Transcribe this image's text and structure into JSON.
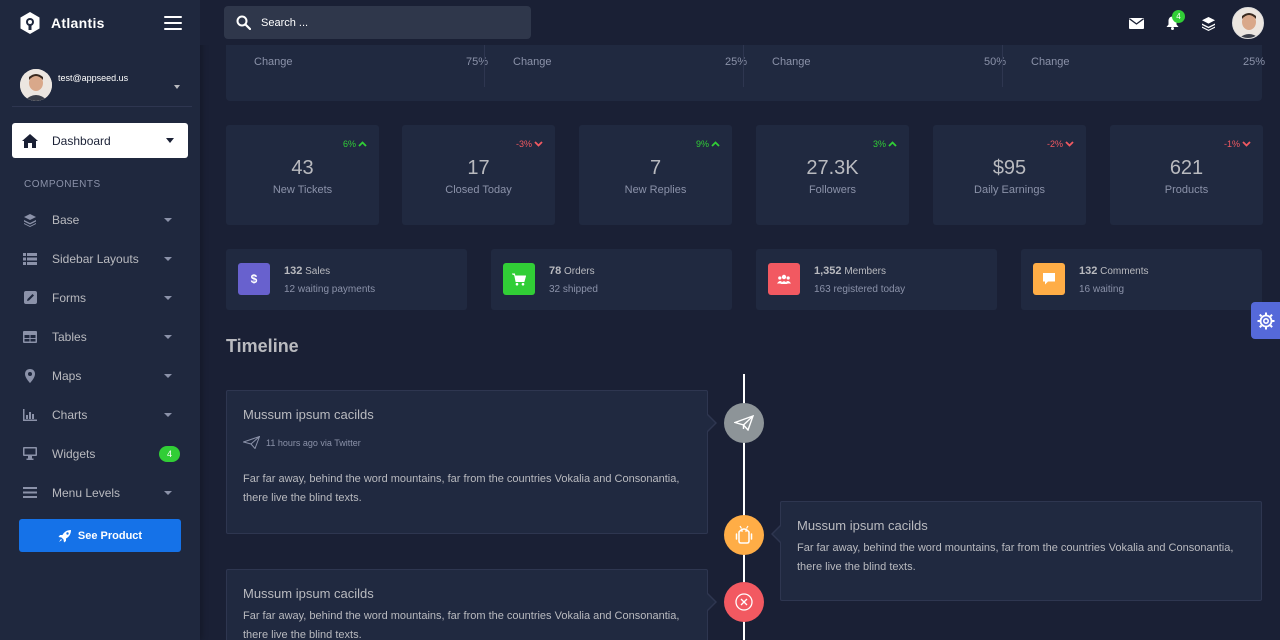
{
  "app": {
    "name": "Atlantis"
  },
  "user": {
    "email": "test@appseed.us"
  },
  "sidebar": {
    "active_item": "Dashboard",
    "section_title": "COMPONENTS",
    "items": [
      {
        "label": "Base",
        "icon": "layers-icon"
      },
      {
        "label": "Sidebar Layouts",
        "icon": "list-icon"
      },
      {
        "label": "Forms",
        "icon": "pen-square-icon"
      },
      {
        "label": "Tables",
        "icon": "table-icon"
      },
      {
        "label": "Maps",
        "icon": "map-marker-icon"
      },
      {
        "label": "Charts",
        "icon": "bar-chart-icon"
      },
      {
        "label": "Widgets",
        "icon": "desktop-icon",
        "badge": "4"
      },
      {
        "label": "Menu Levels",
        "icon": "bars-icon"
      }
    ],
    "cta": "See Product"
  },
  "header": {
    "search_placeholder": "Search ...",
    "notification_count": "4"
  },
  "change_row": [
    {
      "label": "Change",
      "value": "75%"
    },
    {
      "label": "Change",
      "value": "25%"
    },
    {
      "label": "Change",
      "value": "50%"
    },
    {
      "label": "Change",
      "value": "25%"
    }
  ],
  "stats": [
    {
      "pct": "6%",
      "trend": "up",
      "value": "43",
      "label": "New Tickets"
    },
    {
      "pct": "-3%",
      "trend": "down",
      "value": "17",
      "label": "Closed Today"
    },
    {
      "pct": "9%",
      "trend": "up",
      "value": "7",
      "label": "New Replies"
    },
    {
      "pct": "3%",
      "trend": "up",
      "value": "27.3K",
      "label": "Followers"
    },
    {
      "pct": "-2%",
      "trend": "down",
      "value": "$95",
      "label": "Daily Earnings"
    },
    {
      "pct": "-1%",
      "trend": "down",
      "value": "621",
      "label": "Products"
    }
  ],
  "info_cards": [
    {
      "count": "132",
      "title": "Sales",
      "sub": "12 waiting payments",
      "color": "#6861ce",
      "icon": "dollar-icon"
    },
    {
      "count": "78",
      "title": "Orders",
      "sub": "32 shipped",
      "color": "#31ce36",
      "icon": "cart-icon"
    },
    {
      "count": "1,352",
      "title": "Members",
      "sub": "163 registered today",
      "color": "#f25961",
      "icon": "users-icon"
    },
    {
      "count": "132",
      "title": "Comments",
      "sub": "16 waiting",
      "color": "#ffad46",
      "icon": "comment-icon"
    }
  ],
  "timeline": {
    "title": "Timeline",
    "entries": [
      {
        "heading": "Mussum ipsum cacilds",
        "meta": "11 hours ago via Twitter",
        "text": "Far far away, behind the word mountains, far from the countries Vokalia and Consonantia, there live the blind texts."
      },
      {
        "heading": "Mussum ipsum cacilds",
        "text": "Far far away, behind the word mountains, far from the countries Vokalia and Consonantia, there live the blind texts."
      },
      {
        "heading": "Mussum ipsum cacilds",
        "text": "Far far away, behind the word mountains, far from the countries Vokalia and Consonantia, there live the blind texts."
      }
    ]
  },
  "colors": {
    "background": "#1a2035",
    "panel": "#202940",
    "primary": "#1572e8",
    "success": "#31ce36",
    "danger": "#f25961",
    "warning": "#ffad46",
    "secondary": "#6861ce"
  }
}
